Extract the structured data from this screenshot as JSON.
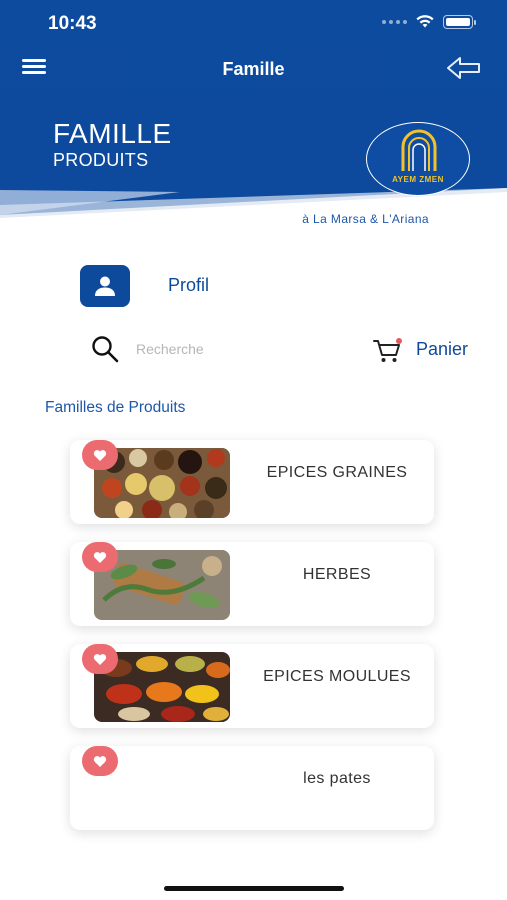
{
  "status_bar": {
    "time": "10:43"
  },
  "header": {
    "title": "Famille",
    "banner_title": "FAMILLE",
    "banner_subtitle": "PRODUITS",
    "logo_text": "AYEM ZMEN",
    "location": "à La Marsa & L'Ariana"
  },
  "profile": {
    "label": "Profil"
  },
  "search": {
    "placeholder": "Recherche"
  },
  "cart": {
    "label": "Panier"
  },
  "section": {
    "title": "Familles de Produits"
  },
  "families": [
    {
      "label": "EPICES GRAINES",
      "image": "spices-grains"
    },
    {
      "label": "HERBES",
      "image": "herbs"
    },
    {
      "label": "EPICES MOULUES",
      "image": "ground-spices"
    },
    {
      "label": "les pates",
      "image": "none"
    }
  ],
  "colors": {
    "primary": "#0e4a9b",
    "favorite": "#ec6b70"
  }
}
